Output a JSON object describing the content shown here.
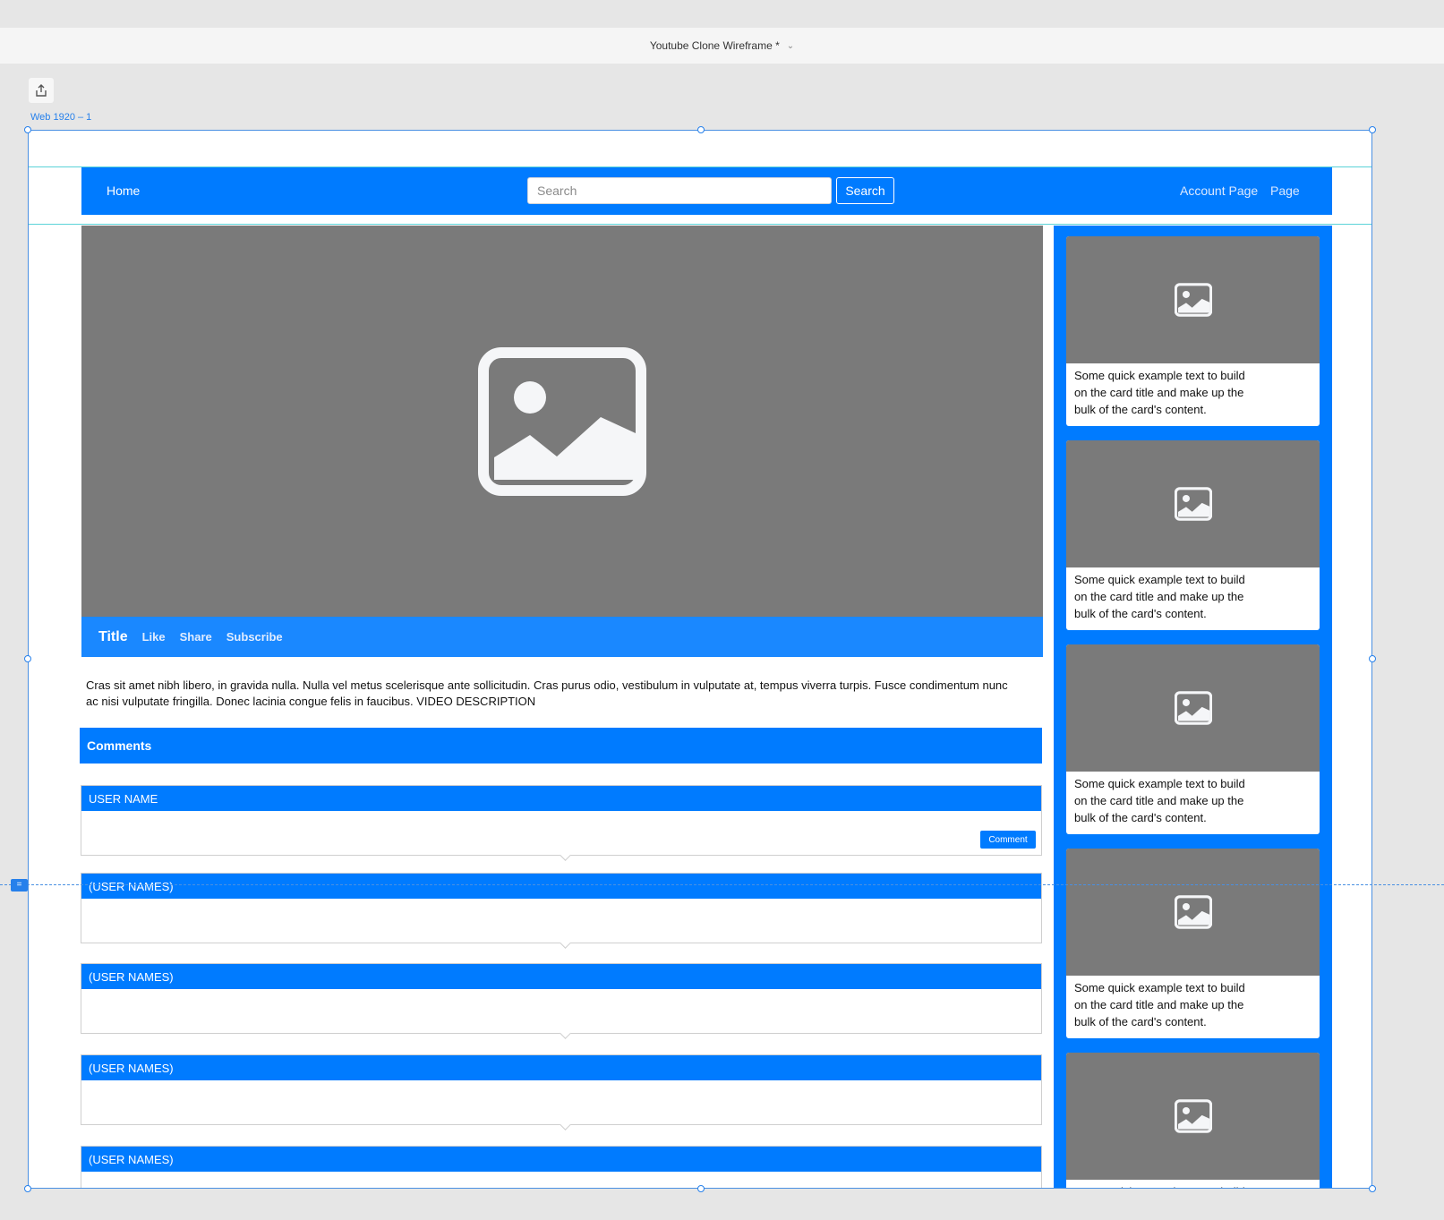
{
  "window": {
    "title": "Youtube Clone Wireframe *",
    "artboard_label": "Web 1920 – 1"
  },
  "navbar": {
    "home": "Home",
    "search_placeholder": "Search",
    "search_button": "Search",
    "account": "Account Page",
    "page": "Page",
    "color": "#007bff"
  },
  "video": {
    "title": "Title",
    "actions": [
      "Like",
      "Share",
      "Subscribe"
    ],
    "description": "Cras sit amet nibh libero, in gravida nulla. Nulla vel metus scelerisque ante sollicitudin. Cras purus odio, vestibulum in vulputate at, tempus viverra turpis. Fusce condimentum nunc ac nisi vulputate fringilla. Donec lacinia congue felis in faucibus. VIDEO DESCRIPTION"
  },
  "comments": {
    "header": "Comments",
    "composer": {
      "user": "USER NAME",
      "button": "Comment"
    },
    "items": [
      "(USER NAMES)",
      "(USER NAMES)",
      "(USER NAMES)",
      "(USER NAMES)"
    ]
  },
  "sidebar": {
    "cards": [
      "Some quick example text to build on the card title and make up the bulk of the card's content.",
      "Some quick example text to build on the card title and make up the bulk of the card's content.",
      "Some quick example text to build on the card title and make up the bulk of the card's content.",
      "Some quick example text to build on the card title and make up the bulk of the card's content.",
      "Some quick example text to build on the card title and make up the bulk of the card's content."
    ]
  },
  "colors": {
    "primary": "#007bff",
    "placeholder_gray": "#7a7a7a",
    "canvas": "#e6e6e6"
  }
}
